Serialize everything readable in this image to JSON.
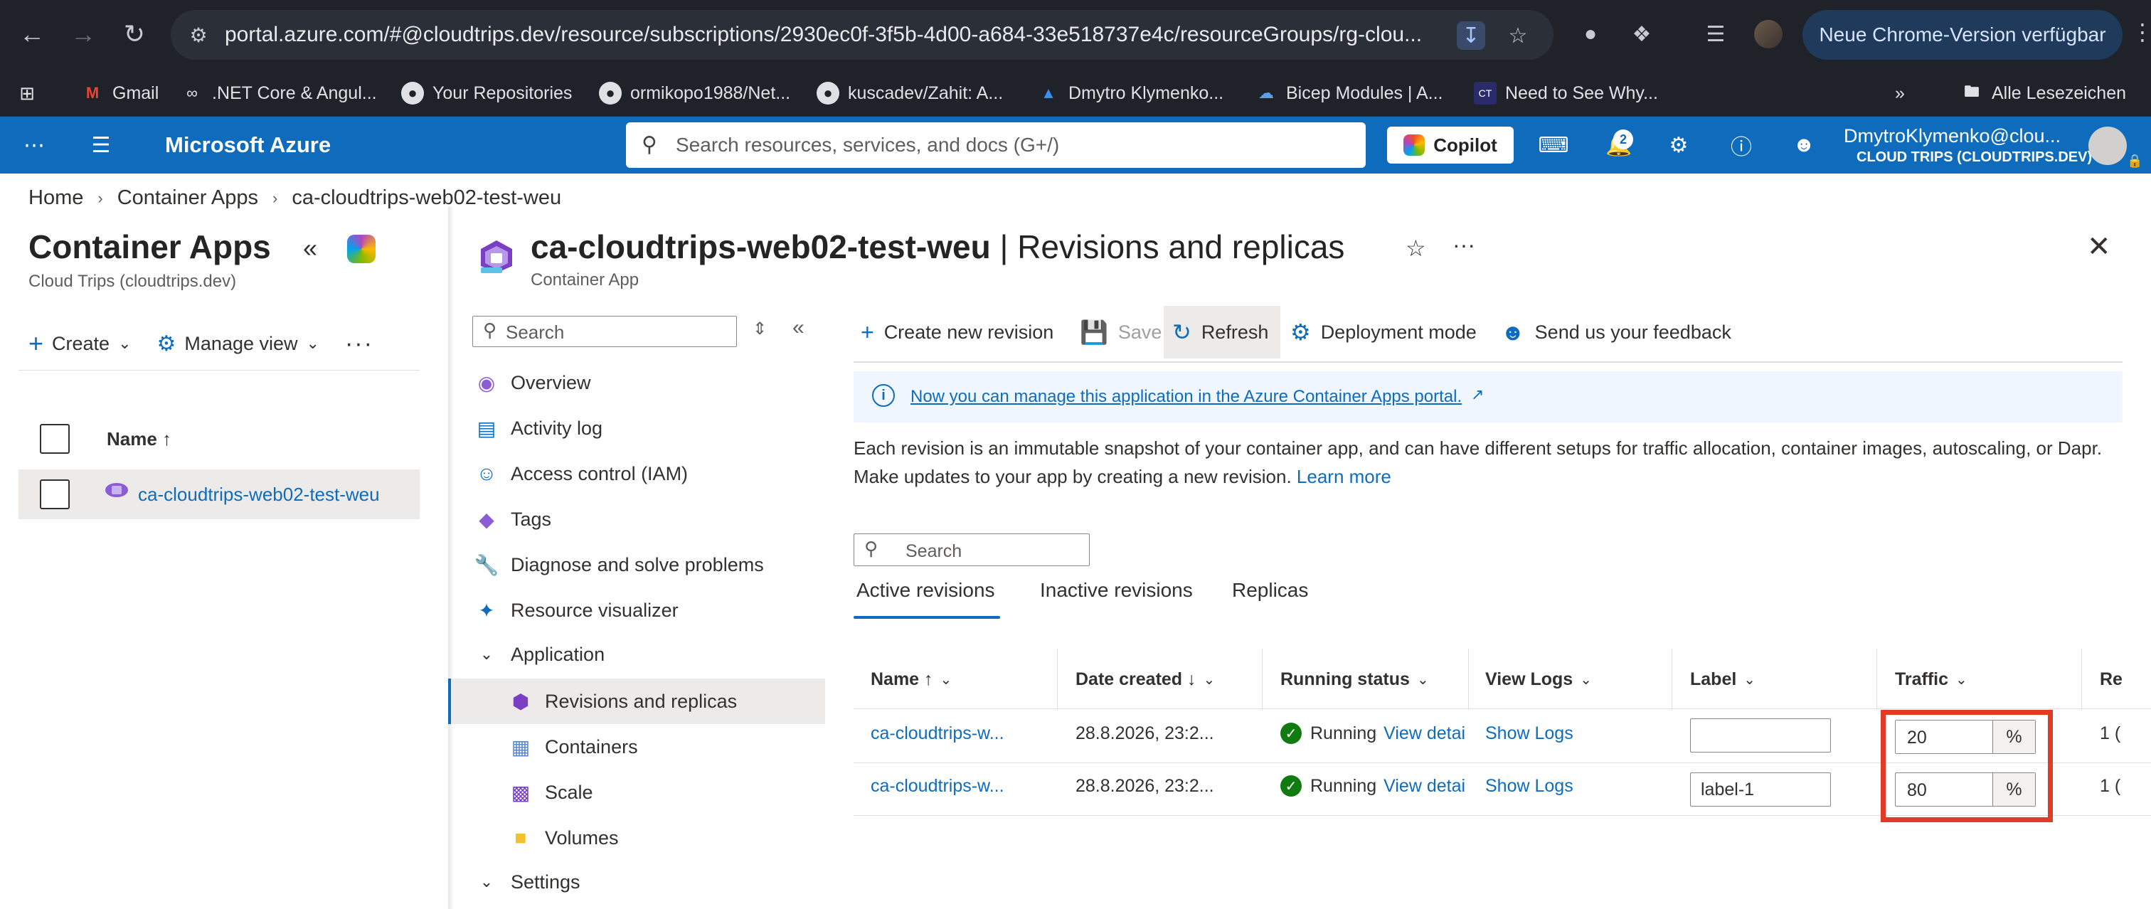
{
  "browser": {
    "url": "portal.azure.com/#@cloudtrips.dev/resource/subscriptions/2930ec0f-3f5b-4d00-a684-33e518737e4c/resourceGroups/rg-clou...",
    "update_label": "Neue Chrome-Version verfügbar",
    "bookmarks": [
      {
        "label": "Gmail",
        "icon": "gmail-icon"
      },
      {
        "label": ".NET Core & Angul...",
        "icon": "infinity-icon"
      },
      {
        "label": "Your Repositories",
        "icon": "github-icon"
      },
      {
        "label": "ormikopo1988/Net...",
        "icon": "github-icon"
      },
      {
        "label": "kuscadev/Zahit: A...",
        "icon": "github-icon"
      },
      {
        "label": "Dmytro Klymenko...",
        "icon": "azure-icon"
      },
      {
        "label": "Bicep Modules | A...",
        "icon": "cloud-icon"
      },
      {
        "label": "Need to See Why...",
        "icon": "ct-icon"
      }
    ],
    "all_bookmarks_label": "Alle Lesezeichen"
  },
  "azure_header": {
    "brand": "Microsoft Azure",
    "search_placeholder": "Search resources, services, and docs (G+/)",
    "copilot_label": "Copilot",
    "notification_count": "2",
    "account_name": "DmytroKlymenko@clou...",
    "account_tenant": "CLOUD TRIPS (CLOUDTRIPS.DEV)"
  },
  "breadcrumb": [
    "Home",
    "Container Apps",
    "ca-cloudtrips-web02-test-weu"
  ],
  "left_blade": {
    "title": "Container Apps",
    "subtitle": "Cloud Trips (cloudtrips.dev)",
    "create_label": "Create",
    "manage_view_label": "Manage view",
    "name_header": "Name ↑",
    "items": [
      "ca-cloudtrips-web02-test-weu"
    ]
  },
  "resource": {
    "name": "ca-cloudtrips-web02-test-weu",
    "page": "Revisions and replicas",
    "type": "Container App"
  },
  "menu": {
    "search_placeholder": "Search",
    "items": [
      {
        "label": "Overview",
        "icon": "overview-icon"
      },
      {
        "label": "Activity log",
        "icon": "activity-log-icon"
      },
      {
        "label": "Access control (IAM)",
        "icon": "iam-icon"
      },
      {
        "label": "Tags",
        "icon": "tag-icon"
      },
      {
        "label": "Diagnose and solve problems",
        "icon": "wrench-icon"
      },
      {
        "label": "Resource visualizer",
        "icon": "visualizer-icon"
      }
    ],
    "application_group": "Application",
    "application_items": [
      {
        "label": "Revisions and replicas",
        "icon": "revisions-icon",
        "active": true
      },
      {
        "label": "Containers",
        "icon": "containers-icon"
      },
      {
        "label": "Scale",
        "icon": "scale-icon"
      },
      {
        "label": "Volumes",
        "icon": "folder-icon"
      }
    ],
    "settings_group": "Settings"
  },
  "toolbar": {
    "create_revision": "Create new revision",
    "save": "Save",
    "refresh": "Refresh",
    "deployment_mode": "Deployment mode",
    "feedback": "Send us your feedback"
  },
  "info": {
    "link_text": "Now you can manage this application in the Azure Container Apps portal."
  },
  "description": {
    "text": "Each revision is an immutable snapshot of your container app, and can have different setups for traffic allocation, container images, autoscaling, or Dapr. Make updates to your app by creating a new revision.",
    "learn_more": "Learn more"
  },
  "revisions": {
    "search_placeholder": "Search",
    "tabs": [
      "Active revisions",
      "Inactive revisions",
      "Replicas"
    ],
    "columns": [
      "Name ↑",
      "Date created ↓",
      "Running status",
      "View Logs",
      "Label",
      "Traffic",
      "Re"
    ],
    "rows": [
      {
        "name": "ca-cloudtrips-w...",
        "date": "28.8.2026, 23:2...",
        "status": "Running",
        "details": "View detai",
        "logs": "Show Logs",
        "label": "",
        "traffic": "20",
        "replicas": "1 ("
      },
      {
        "name": "ca-cloudtrips-w...",
        "date": "28.8.2026, 23:2...",
        "status": "Running",
        "details": "View detai",
        "logs": "Show Logs",
        "label": "label-1",
        "traffic": "80",
        "replicas": "1 ("
      }
    ],
    "percent_suffix": "%"
  },
  "colors": {
    "azure_blue": "#0f6cbd",
    "highlight_red": "#e03b24",
    "running_green": "#107c10"
  }
}
